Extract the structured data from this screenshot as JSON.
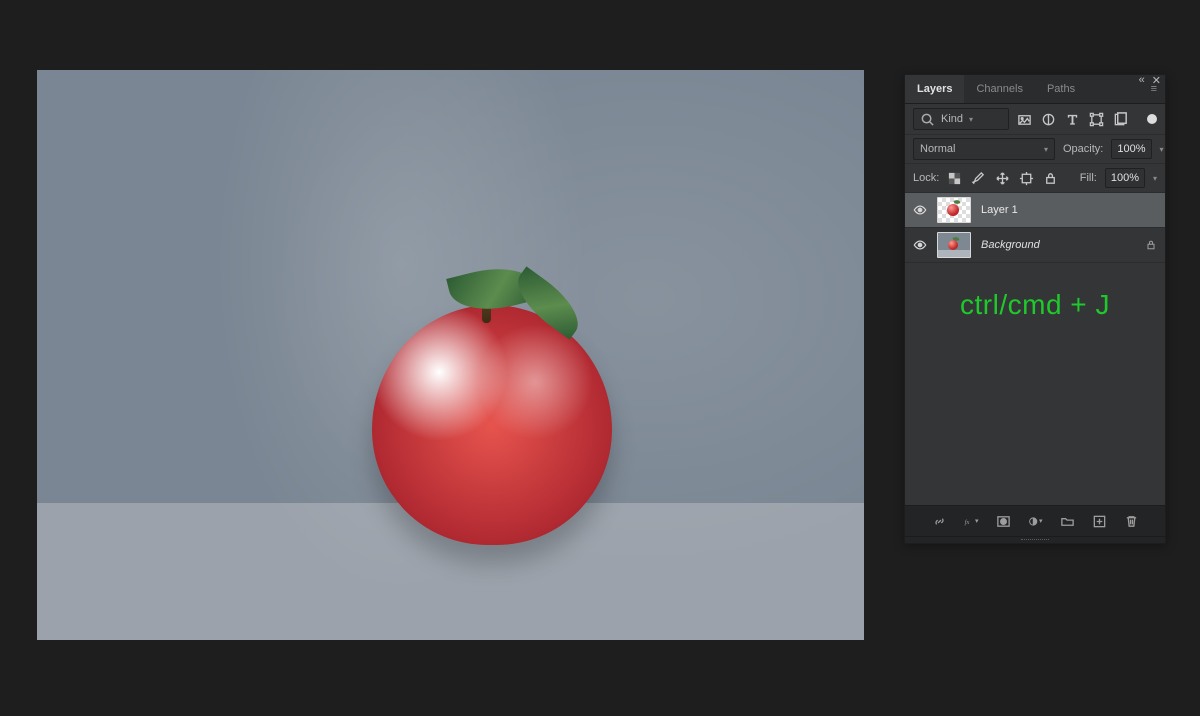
{
  "tabs": {
    "layers": "Layers",
    "channels": "Channels",
    "paths": "Paths"
  },
  "filter": {
    "kind_label": "Kind"
  },
  "blend": {
    "mode": "Normal",
    "opacity_label": "Opacity:",
    "opacity_value": "100%"
  },
  "lock": {
    "label": "Lock:",
    "fill_label": "Fill:",
    "fill_value": "100%"
  },
  "layers": [
    {
      "name": "Layer 1",
      "italic": false,
      "selected": true,
      "transparent_thumb": true,
      "locked": false
    },
    {
      "name": "Background",
      "italic": true,
      "selected": false,
      "transparent_thumb": false,
      "locked": true
    }
  ],
  "shortcut_text": "ctrl/cmd + J"
}
